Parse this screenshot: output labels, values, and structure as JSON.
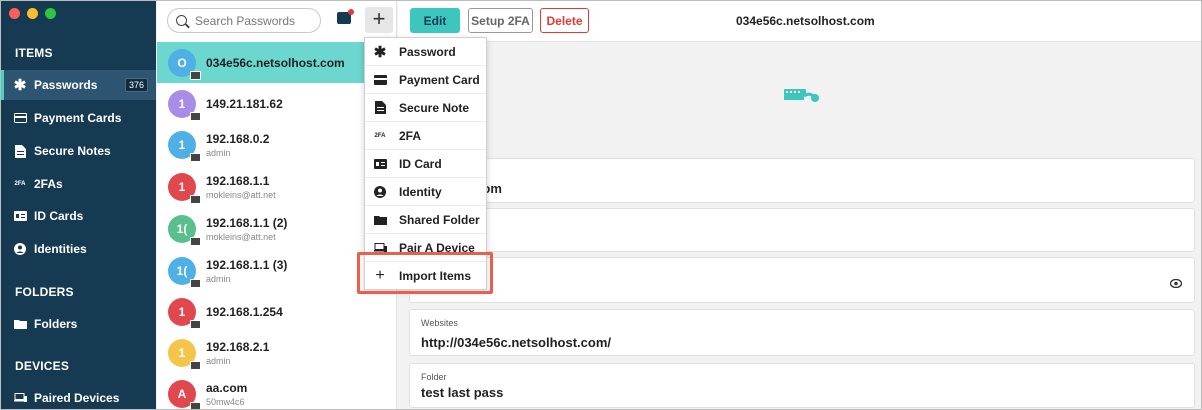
{
  "sidebar": {
    "sections": {
      "items": "ITEMS",
      "folders": "FOLDERS",
      "devices": "DEVICES"
    },
    "items": [
      {
        "label": "Passwords",
        "icon": "asterisk-icon",
        "count": "376"
      },
      {
        "label": "Payment Cards",
        "icon": "card-icon"
      },
      {
        "label": "Secure Notes",
        "icon": "note-icon"
      },
      {
        "label": "2FAs",
        "icon": "2fa-icon",
        "glyph": "2FA"
      },
      {
        "label": "ID Cards",
        "icon": "id-card-icon"
      },
      {
        "label": "Identities",
        "icon": "identity-icon"
      }
    ],
    "folders_item": {
      "label": "Folders"
    },
    "devices_item": {
      "label": "Paired Devices"
    }
  },
  "list": {
    "search_placeholder": "Search Passwords",
    "items": [
      {
        "initial": "O",
        "title": "034e56c.netsolhost.com",
        "sub": "",
        "color": "#4fb0e6"
      },
      {
        "initial": "1",
        "title": "149.21.181.62",
        "sub": "",
        "color": "#a98be8"
      },
      {
        "initial": "1",
        "title": "192.168.0.2",
        "sub": "admin",
        "color": "#4fb0e6"
      },
      {
        "initial": "1",
        "title": "192.168.1.1",
        "sub": "mokleins@att.net",
        "color": "#e0484e"
      },
      {
        "initial": "1(",
        "title": "192.168.1.1 (2)",
        "sub": "mokleins@att.net",
        "color": "#57c08c"
      },
      {
        "initial": "1(",
        "title": "192.168.1.1 (3)",
        "sub": "admin",
        "color": "#4fb0e6"
      },
      {
        "initial": "1",
        "title": "192.168.1.254",
        "sub": "",
        "color": "#e0484e"
      },
      {
        "initial": "1",
        "title": "192.168.2.1",
        "sub": "admin",
        "color": "#f5c54a"
      },
      {
        "initial": "A",
        "title": "aa.com",
        "sub": "50mw4c6",
        "color": "#e0484e"
      }
    ]
  },
  "menu": {
    "items": [
      {
        "label": "Password",
        "icon": "asterisk-icon"
      },
      {
        "label": "Payment Card",
        "icon": "card-icon"
      },
      {
        "label": "Secure Note",
        "icon": "note-icon"
      },
      {
        "label": "2FA",
        "icon": "2fa-icon",
        "glyph": "2FA"
      },
      {
        "label": "ID Card",
        "icon": "id-card-icon"
      },
      {
        "label": "Identity",
        "icon": "identity-icon"
      },
      {
        "label": "Shared Folder",
        "icon": "folder-icon"
      },
      {
        "label": "Pair A Device",
        "icon": "device-icon"
      },
      {
        "label": "Import Items",
        "icon": "plus-icon"
      }
    ]
  },
  "detail": {
    "edit_label": "Edit",
    "setup_label": "Setup 2FA",
    "delete_label": "Delete",
    "title": "034e56c.netsolhost.com",
    "field1_partial": "tsolhost.com",
    "websites_label": "Websites",
    "websites_value": "http://034e56c.netsolhost.com/",
    "folder_label": "Folder",
    "folder_value": "test last pass"
  },
  "colors": {
    "sidebar": "#163a52",
    "accent": "#3cc6bd",
    "selected_row": "#6cd7cf",
    "delete": "#e53935",
    "highlight": "#e8604c"
  }
}
